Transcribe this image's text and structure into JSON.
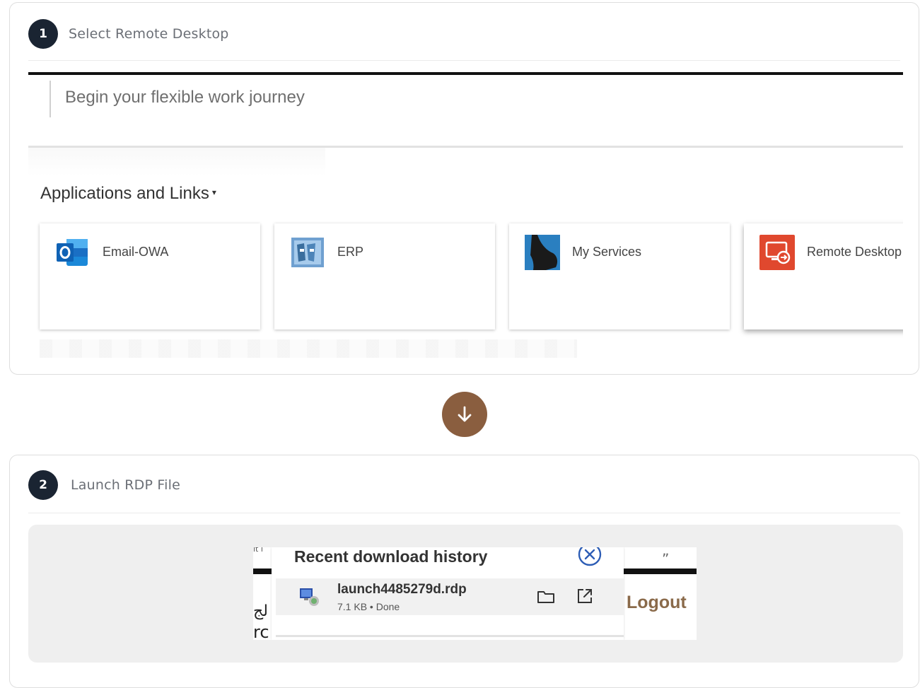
{
  "step1": {
    "number": "1",
    "title": "Select Remote Desktop",
    "screenshot": {
      "journey_text": "Begin your flexible work journey",
      "apps_title": "Applications and Links",
      "apps_caret": "▾",
      "tiles": [
        {
          "label": "Email-OWA",
          "icon": "outlook-icon"
        },
        {
          "label": "ERP",
          "icon": "erp-icon"
        },
        {
          "label": "My Services",
          "icon": "my-services-icon"
        },
        {
          "label": "Remote Desktop",
          "icon": "remote-desktop-icon"
        }
      ]
    }
  },
  "arrow": {
    "icon": "arrow-down-icon",
    "color": "#8a5e3f"
  },
  "step2": {
    "number": "2",
    "title": "Launch RDP File",
    "screenshot": {
      "panel_title": "Recent download history",
      "file_name": "launch4485279d.rdp",
      "file_meta": "7.1 KB • Done",
      "logout_label": "Logout",
      "fragment_arabic": "لج",
      "fragment_latin": "rc"
    }
  }
}
